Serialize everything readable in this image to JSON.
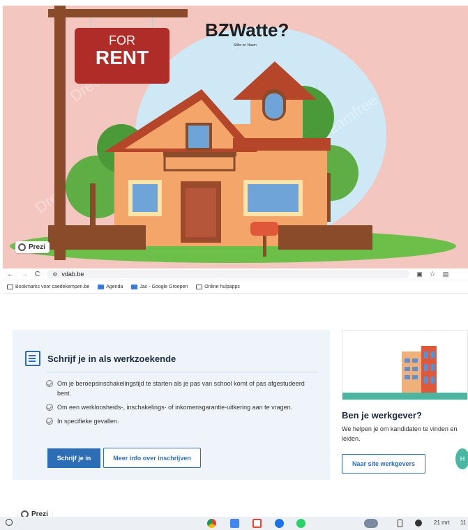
{
  "slide": {
    "title": "BZWatte?",
    "subtitle": "Stilte en Naam",
    "sign": {
      "line1": "FOR",
      "line2": "RENT"
    },
    "watermark": "Dreamfree",
    "prezi_badge": "Prezi"
  },
  "browser": {
    "nav": {
      "back": "←",
      "forward": "→",
      "reload": "C"
    },
    "url": "vdab.be",
    "bookmarks": [
      {
        "label": "Bookmarks voor caedekempen.be"
      },
      {
        "label": "Agenda"
      },
      {
        "label": "Jac - Google Groepen"
      },
      {
        "label": "Online hulpapps"
      }
    ]
  },
  "page": {
    "jobseeker_card": {
      "title": "Schrijf je in als werkzoekende",
      "bullets": [
        "Om je beroepsinschakelingstijd te starten als je pas van school komt of pas afgestudeerd bent.",
        "Om een werkloosheids-, inschakelings- of inkomensgarantie-uitkering aan te vragen.",
        "In specifieke gevallen."
      ],
      "primary_button": "Schrijf je in",
      "secondary_button": "Meer info over inschrijven"
    },
    "employer_card": {
      "title": "Ben je werkgever?",
      "text": "We helpen je om kandidaten te vinden en leiden.",
      "button": "Naar site werkgevers",
      "bubble": "H"
    },
    "prezi_badge": "Prezi"
  },
  "taskbar": {
    "date": "21 mrt",
    "time": "11"
  },
  "colors": {
    "slide_bg": "#f4c6c0",
    "brand_blue": "#2d6db5",
    "card_bg": "#eef4fa",
    "teal": "#4bb7a3"
  }
}
